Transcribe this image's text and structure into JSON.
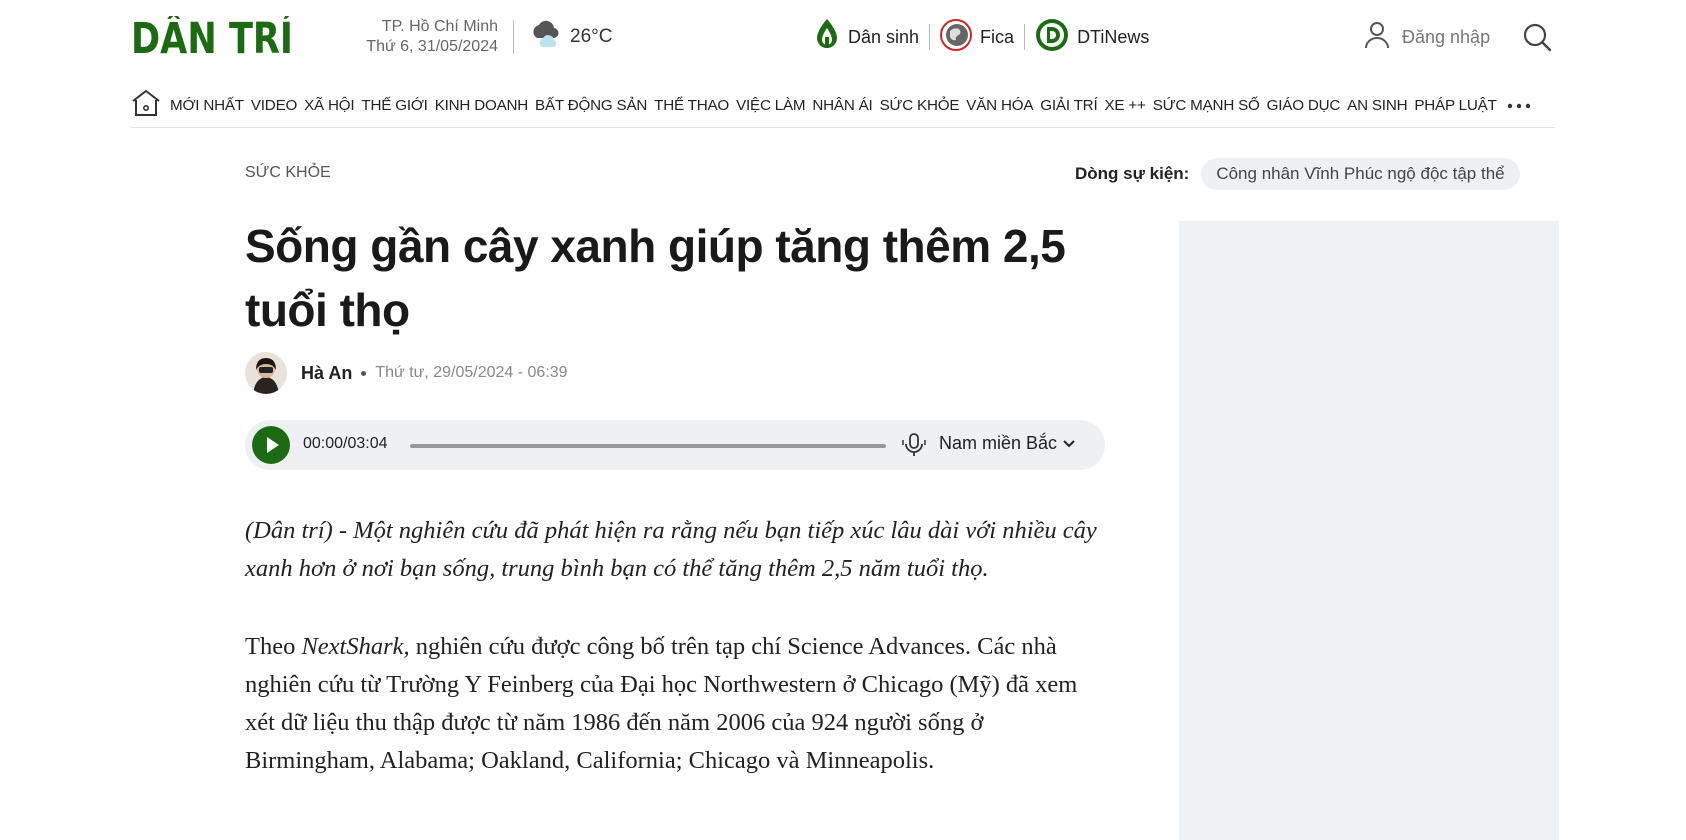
{
  "header": {
    "logo_text": "DÂN TRÍ",
    "location": {
      "city": "TP. Hồ Chí Minh",
      "date": "Thứ 6, 31/05/2024"
    },
    "weather": {
      "icon": "cloud-rain-icon",
      "temp": "26°C"
    },
    "quick_links": [
      {
        "label": "Dân sinh",
        "icon": "dan-sinh-logo-icon"
      },
      {
        "label": "Fica",
        "icon": "fica-globe-icon"
      },
      {
        "label": "DTiNews",
        "icon": "dtinews-logo-icon"
      }
    ],
    "login_label": "Đăng nhập",
    "search_icon": "search-icon"
  },
  "nav": {
    "items": [
      "MỚI NHẤT",
      "VIDEO",
      "XÃ HỘI",
      "THẾ GIỚI",
      "KINH DOANH",
      "BẤT ĐỘNG SẢN",
      "THỂ THAO",
      "VIỆC LÀM",
      "NHÂN ÁI",
      "SỨC KHỎE",
      "VĂN HÓA",
      "GIẢI TRÍ",
      "XE ++",
      "SỨC MẠNH SỐ",
      "GIÁO DỤC",
      "AN SINH",
      "PHÁP LUẬT"
    ]
  },
  "article": {
    "category": "SỨC KHỎE",
    "event_label": "Dòng sự kiện:",
    "event_tag": "Công nhân Vĩnh Phúc ngộ độc tập thể",
    "title": "Sống gần cây xanh giúp tăng thêm 2,5 tuổi thọ",
    "author": "Hà An",
    "published": "Thứ tư, 29/05/2024 - 06:39",
    "audio": {
      "time": "00:00/03:04",
      "voice": "Nam miền Bắc",
      "progress": 0
    },
    "sapo": "(Dân trí) - Một nghiên cứu đã phát hiện ra rằng nếu bạn tiếp xúc lâu dài với nhiều cây xanh hơn ở nơi bạn sống, trung bình bạn có thể tăng thêm 2,5 năm tuổi thọ.",
    "para1_prefix": "Theo ",
    "para1_source": "NextShark,",
    "para1_text": " nghiên cứu được công bố trên tạp chí Science Advances. Các nhà nghiên cứu từ Trường Y Feinberg của Đại học Northwestern ở Chicago (Mỹ) đã xem xét dữ liệu thu thập được từ năm 1986 đến năm 2006 của 924 người sống ở Birmingham, Alabama; Oakland, California; Chicago và Minneapolis."
  },
  "colors": {
    "brand_green": "#1c6b12",
    "pill_bg": "#eef1f4",
    "ad_bg": "#eff2f5"
  }
}
